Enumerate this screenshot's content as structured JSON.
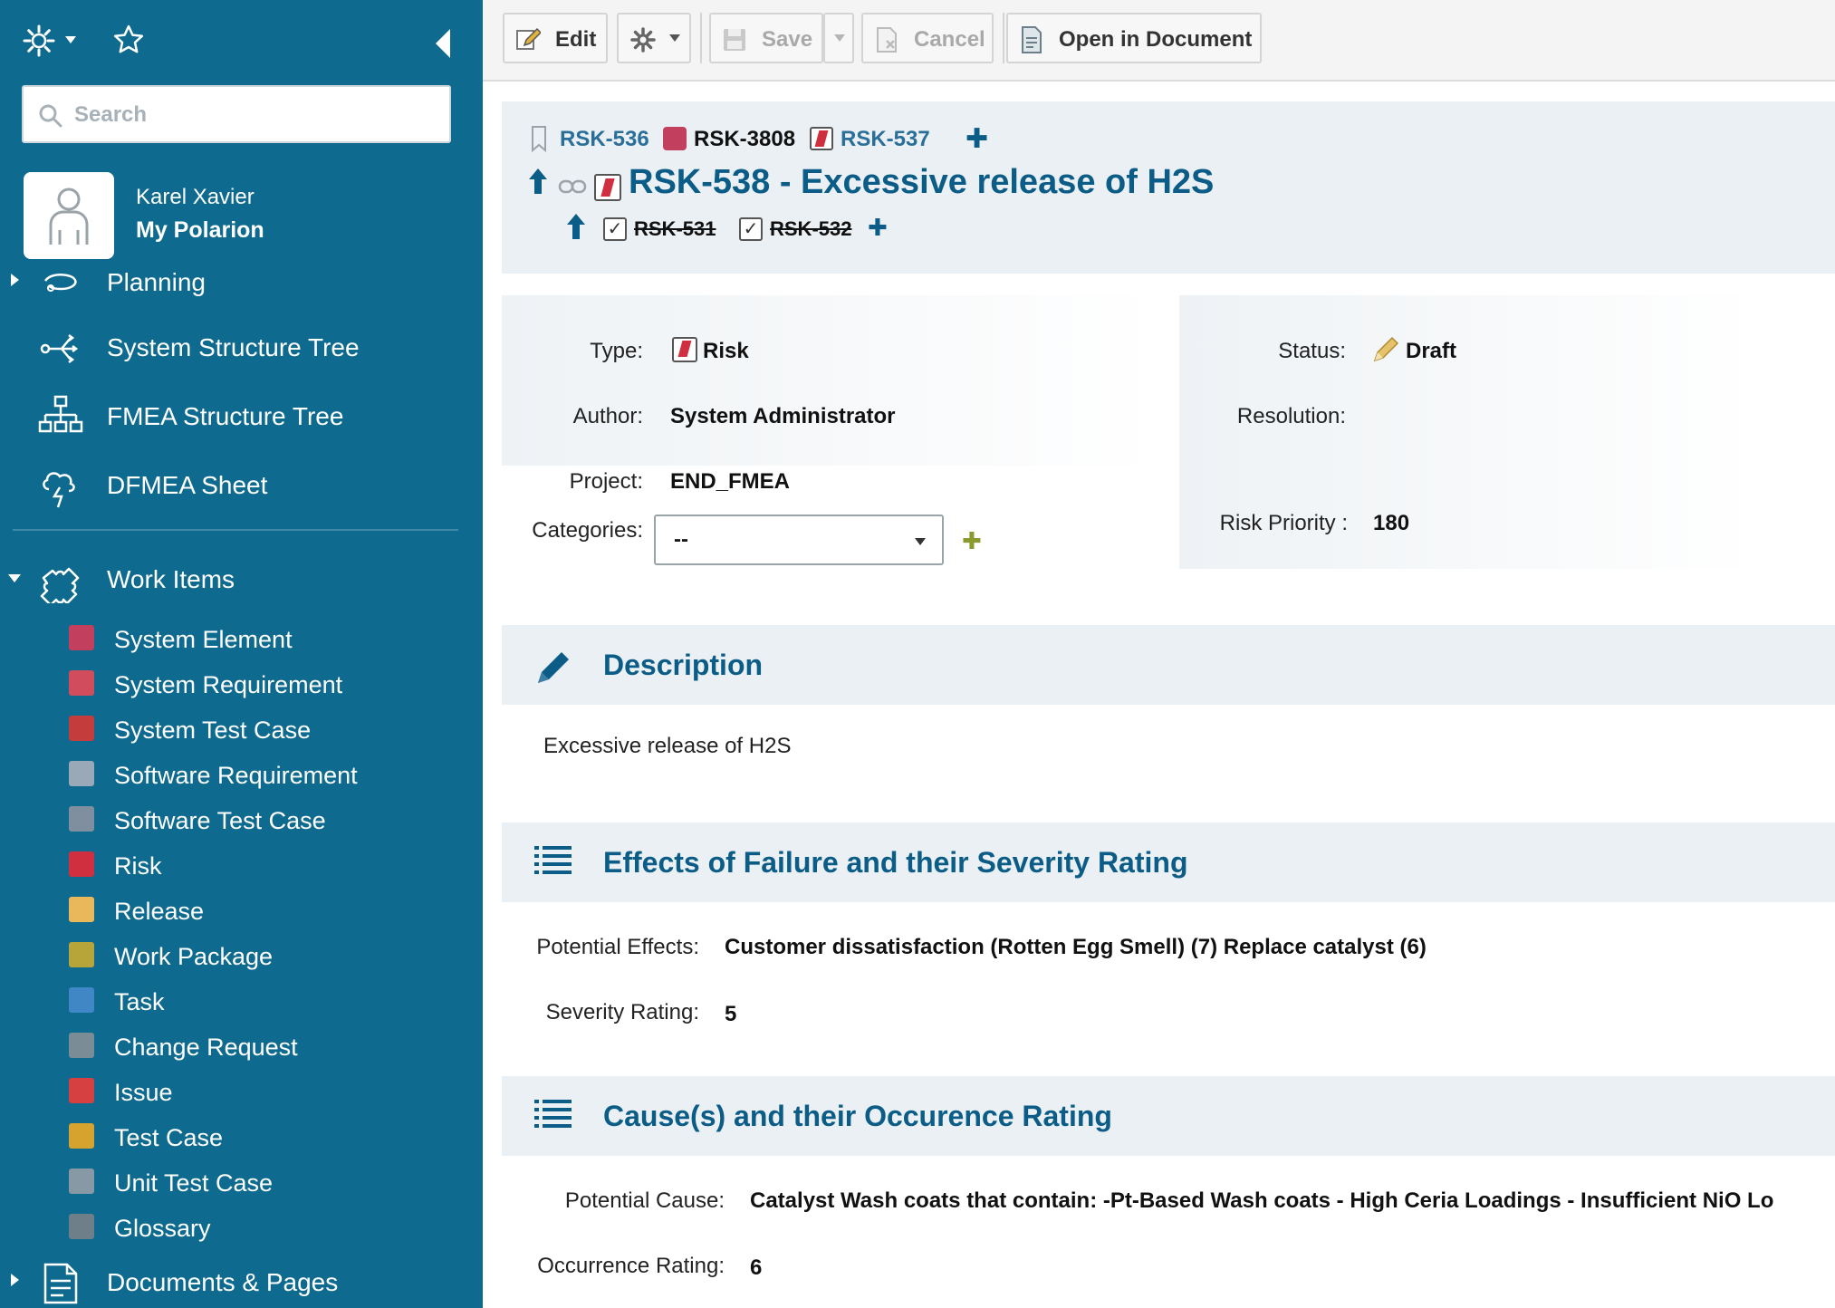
{
  "sidebar": {
    "search_placeholder": "Search",
    "user": {
      "name": "Karel Xavier",
      "link": "My Polarion"
    },
    "nav": [
      {
        "label": "Planning",
        "icon": "planning-icon"
      },
      {
        "label": "System Structure Tree",
        "icon": "tree-branch-icon"
      },
      {
        "label": "FMEA Structure Tree",
        "icon": "hierarchy-icon"
      },
      {
        "label": "DFMEA Sheet",
        "icon": "cloud-bolt-icon"
      },
      {
        "label": "Work Items",
        "icon": "puzzle-icon"
      },
      {
        "label": "Documents & Pages",
        "icon": "document-icon"
      }
    ],
    "work_items": [
      {
        "label": "System Element",
        "icon": "system-element-icon",
        "color": "#c2405e"
      },
      {
        "label": "System Requirement",
        "icon": "system-requirement-icon",
        "color": "#d14c5c"
      },
      {
        "label": "System Test Case",
        "icon": "system-test-case-icon",
        "color": "#c43c3c"
      },
      {
        "label": "Software Requirement",
        "icon": "software-requirement-icon",
        "color": "#9aa9b8"
      },
      {
        "label": "Software Test Case",
        "icon": "software-test-case-icon",
        "color": "#7f8fa0"
      },
      {
        "label": "Risk",
        "icon": "risk-icon",
        "color": "#d02f3f"
      },
      {
        "label": "Release",
        "icon": "release-icon",
        "color": "#e8b85a"
      },
      {
        "label": "Work Package",
        "icon": "work-package-icon",
        "color": "#b7a53a"
      },
      {
        "label": "Task",
        "icon": "task-icon",
        "color": "#3f88c5"
      },
      {
        "label": "Change Request",
        "icon": "change-request-icon",
        "color": "#7a8c96"
      },
      {
        "label": "Issue",
        "icon": "issue-icon",
        "color": "#d64040"
      },
      {
        "label": "Test Case",
        "icon": "test-case-icon",
        "color": "#d6a32e"
      },
      {
        "label": "Unit Test Case",
        "icon": "unit-test-case-icon",
        "color": "#8899a6"
      },
      {
        "label": "Glossary",
        "icon": "glossary-icon",
        "color": "#6f7f8a"
      }
    ]
  },
  "toolbar": {
    "edit": "Edit",
    "save": "Save",
    "cancel": "Cancel",
    "open_in_document": "Open in Document"
  },
  "header": {
    "parents": [
      "RSK-536",
      "RSK-3808",
      "RSK-537"
    ],
    "title": "RSK-538 - Excessive release of H2S",
    "children": [
      "RSK-531",
      "RSK-532"
    ]
  },
  "fields": {
    "type_label": "Type:",
    "type_value": "Risk",
    "author_label": "Author:",
    "author_value": "System Administrator",
    "project_label": "Project:",
    "project_value": "END_FMEA",
    "categories_label": "Categories:",
    "categories_value": "--",
    "status_label": "Status:",
    "status_value": "Draft",
    "resolution_label": "Resolution:",
    "risk_priority_label": "Risk Priority :",
    "risk_priority_value": "180"
  },
  "description": {
    "title": "Description",
    "text": "Excessive release of H2S"
  },
  "effects": {
    "title": "Effects of Failure and their Severity Rating",
    "potential_effects_label": "Potential Effects:",
    "potential_effects_value": "Customer dissatisfaction (Rotten Egg Smell) (7) Replace catalyst (6)",
    "severity_label": "Severity Rating:",
    "severity_value": "5"
  },
  "causes": {
    "title": "Cause(s) and their Occurence Rating",
    "potential_cause_label": "Potential Cause:",
    "potential_cause_value": "Catalyst Wash coats that contain: -Pt-Based Wash coats - High Ceria Loadings - Insufficient NiO Lo",
    "occurrence_label": "Occurrence Rating:",
    "occurrence_value": "6"
  },
  "colors": {
    "sidebar_bg": "#0f6a8f",
    "accent_title": "#0b5c86",
    "section_bg": "#ebf0f4"
  }
}
